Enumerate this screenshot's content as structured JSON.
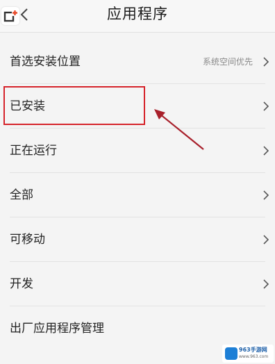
{
  "header": {
    "title": "应用程序",
    "back_icon": "chevron-left-icon",
    "app_badge_icon": "app-add-icon"
  },
  "settings": {
    "items": [
      {
        "label": "首选安装位置",
        "value": "系统空间优先"
      },
      {
        "label": "已安装"
      },
      {
        "label": "正在运行"
      },
      {
        "label": "全部"
      },
      {
        "label": "可移动"
      },
      {
        "label": "开发"
      },
      {
        "label": "出厂应用程序管理"
      }
    ]
  },
  "annotation": {
    "highlight_color": "#d6232a",
    "arrow_color": "#a8202b"
  },
  "watermark": {
    "text": "963手游网",
    "sub": "www.963.com"
  }
}
